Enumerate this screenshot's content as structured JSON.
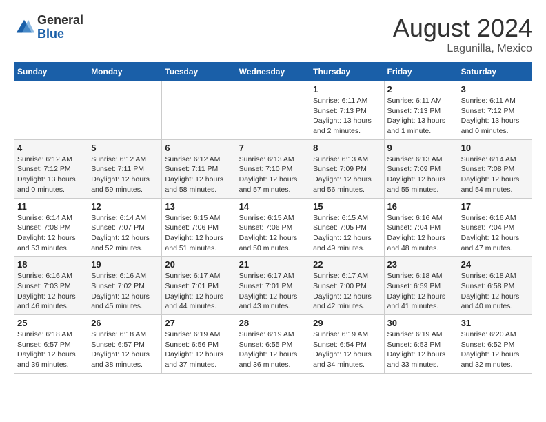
{
  "logo": {
    "general": "General",
    "blue": "Blue"
  },
  "title": {
    "month_year": "August 2024",
    "location": "Lagunilla, Mexico"
  },
  "headers": [
    "Sunday",
    "Monday",
    "Tuesday",
    "Wednesday",
    "Thursday",
    "Friday",
    "Saturday"
  ],
  "weeks": [
    {
      "days": [
        {
          "num": "",
          "info": ""
        },
        {
          "num": "",
          "info": ""
        },
        {
          "num": "",
          "info": ""
        },
        {
          "num": "",
          "info": ""
        },
        {
          "num": "1",
          "info": "Sunrise: 6:11 AM\nSunset: 7:13 PM\nDaylight: 13 hours\nand 2 minutes."
        },
        {
          "num": "2",
          "info": "Sunrise: 6:11 AM\nSunset: 7:13 PM\nDaylight: 13 hours\nand 1 minute."
        },
        {
          "num": "3",
          "info": "Sunrise: 6:11 AM\nSunset: 7:12 PM\nDaylight: 13 hours\nand 0 minutes."
        }
      ]
    },
    {
      "days": [
        {
          "num": "4",
          "info": "Sunrise: 6:12 AM\nSunset: 7:12 PM\nDaylight: 13 hours\nand 0 minutes."
        },
        {
          "num": "5",
          "info": "Sunrise: 6:12 AM\nSunset: 7:11 PM\nDaylight: 12 hours\nand 59 minutes."
        },
        {
          "num": "6",
          "info": "Sunrise: 6:12 AM\nSunset: 7:11 PM\nDaylight: 12 hours\nand 58 minutes."
        },
        {
          "num": "7",
          "info": "Sunrise: 6:13 AM\nSunset: 7:10 PM\nDaylight: 12 hours\nand 57 minutes."
        },
        {
          "num": "8",
          "info": "Sunrise: 6:13 AM\nSunset: 7:09 PM\nDaylight: 12 hours\nand 56 minutes."
        },
        {
          "num": "9",
          "info": "Sunrise: 6:13 AM\nSunset: 7:09 PM\nDaylight: 12 hours\nand 55 minutes."
        },
        {
          "num": "10",
          "info": "Sunrise: 6:14 AM\nSunset: 7:08 PM\nDaylight: 12 hours\nand 54 minutes."
        }
      ]
    },
    {
      "days": [
        {
          "num": "11",
          "info": "Sunrise: 6:14 AM\nSunset: 7:08 PM\nDaylight: 12 hours\nand 53 minutes."
        },
        {
          "num": "12",
          "info": "Sunrise: 6:14 AM\nSunset: 7:07 PM\nDaylight: 12 hours\nand 52 minutes."
        },
        {
          "num": "13",
          "info": "Sunrise: 6:15 AM\nSunset: 7:06 PM\nDaylight: 12 hours\nand 51 minutes."
        },
        {
          "num": "14",
          "info": "Sunrise: 6:15 AM\nSunset: 7:06 PM\nDaylight: 12 hours\nand 50 minutes."
        },
        {
          "num": "15",
          "info": "Sunrise: 6:15 AM\nSunset: 7:05 PM\nDaylight: 12 hours\nand 49 minutes."
        },
        {
          "num": "16",
          "info": "Sunrise: 6:16 AM\nSunset: 7:04 PM\nDaylight: 12 hours\nand 48 minutes."
        },
        {
          "num": "17",
          "info": "Sunrise: 6:16 AM\nSunset: 7:04 PM\nDaylight: 12 hours\nand 47 minutes."
        }
      ]
    },
    {
      "days": [
        {
          "num": "18",
          "info": "Sunrise: 6:16 AM\nSunset: 7:03 PM\nDaylight: 12 hours\nand 46 minutes."
        },
        {
          "num": "19",
          "info": "Sunrise: 6:16 AM\nSunset: 7:02 PM\nDaylight: 12 hours\nand 45 minutes."
        },
        {
          "num": "20",
          "info": "Sunrise: 6:17 AM\nSunset: 7:01 PM\nDaylight: 12 hours\nand 44 minutes."
        },
        {
          "num": "21",
          "info": "Sunrise: 6:17 AM\nSunset: 7:01 PM\nDaylight: 12 hours\nand 43 minutes."
        },
        {
          "num": "22",
          "info": "Sunrise: 6:17 AM\nSunset: 7:00 PM\nDaylight: 12 hours\nand 42 minutes."
        },
        {
          "num": "23",
          "info": "Sunrise: 6:18 AM\nSunset: 6:59 PM\nDaylight: 12 hours\nand 41 minutes."
        },
        {
          "num": "24",
          "info": "Sunrise: 6:18 AM\nSunset: 6:58 PM\nDaylight: 12 hours\nand 40 minutes."
        }
      ]
    },
    {
      "days": [
        {
          "num": "25",
          "info": "Sunrise: 6:18 AM\nSunset: 6:57 PM\nDaylight: 12 hours\nand 39 minutes."
        },
        {
          "num": "26",
          "info": "Sunrise: 6:18 AM\nSunset: 6:57 PM\nDaylight: 12 hours\nand 38 minutes."
        },
        {
          "num": "27",
          "info": "Sunrise: 6:19 AM\nSunset: 6:56 PM\nDaylight: 12 hours\nand 37 minutes."
        },
        {
          "num": "28",
          "info": "Sunrise: 6:19 AM\nSunset: 6:55 PM\nDaylight: 12 hours\nand 36 minutes."
        },
        {
          "num": "29",
          "info": "Sunrise: 6:19 AM\nSunset: 6:54 PM\nDaylight: 12 hours\nand 34 minutes."
        },
        {
          "num": "30",
          "info": "Sunrise: 6:19 AM\nSunset: 6:53 PM\nDaylight: 12 hours\nand 33 minutes."
        },
        {
          "num": "31",
          "info": "Sunrise: 6:20 AM\nSunset: 6:52 PM\nDaylight: 12 hours\nand 32 minutes."
        }
      ]
    }
  ]
}
